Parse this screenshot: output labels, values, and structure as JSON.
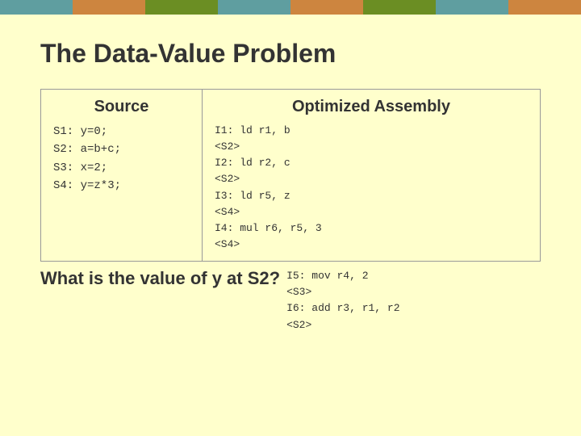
{
  "topbar": {
    "segments": [
      "seg-1",
      "seg-2",
      "seg-3",
      "seg-4",
      "seg-5",
      "seg-6",
      "seg-7",
      "seg-8"
    ]
  },
  "title": "The Data-Value Problem",
  "table": {
    "source_header": "Source",
    "optimized_header": "Optimized Assembly",
    "source_lines": [
      "S1:  y=0;",
      "S2:  a=b+c;",
      "S3:  x=2;",
      "S4:  y=z*3;"
    ],
    "asm_lines": [
      "I1:  ld r1, b",
      "<S2>",
      "I2:  ld r2, c",
      "<S2>",
      "I3:  ld r5, z",
      "<S4>",
      "I4:  mul r6, r5, 3",
      "<S4>"
    ],
    "bottom_question": "What is the value of y at S2?",
    "remaining_asm": [
      "I5:  mov r4, 2",
      "<S3>",
      "I6:  add r3, r1, r2",
      "<S2>"
    ]
  }
}
